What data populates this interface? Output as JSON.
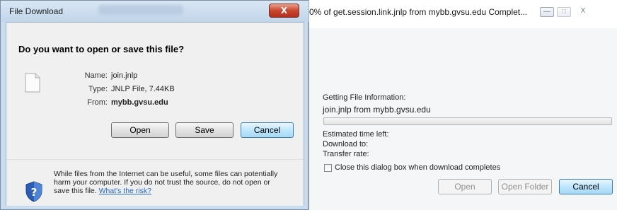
{
  "left_dialog": {
    "title": "File Download",
    "question": "Do you want to open or save this file?",
    "file_info": [
      {
        "label": "Name:",
        "value": "join.jnlp",
        "bold": false
      },
      {
        "label": "Type:",
        "value": "JNLP File, 7.44KB",
        "bold": false
      },
      {
        "label": "From:",
        "value": "mybb.gvsu.edu",
        "bold": true
      }
    ],
    "buttons": {
      "open": "Open",
      "save": "Save",
      "cancel": "Cancel"
    },
    "warning_text": "While files from the Internet can be useful, some files can potentially harm your computer. If you do not trust the source, do not open or save this file.",
    "warning_link": "What's the risk?",
    "close_glyph": "X"
  },
  "right_dialog": {
    "title": "0% of get.session.link.jnlp from mybb.gvsu.edu Complet...",
    "status": "Getting File Information:",
    "file_line": "join.jnlp from mybb.gvsu.edu",
    "progress_fraction": 0,
    "estimated_time_label": "Estimated time left:",
    "download_to_label": "Download to:",
    "transfer_rate_label": "Transfer rate:",
    "checkbox_label": "Close this dialog box when download completes",
    "checkbox_checked": false,
    "buttons": {
      "open": "Open",
      "open_folder": "Open Folder",
      "cancel": "Cancel"
    },
    "caption_glyphs": {
      "minimize": "—",
      "maximize": "□",
      "close": "X"
    }
  },
  "colors": {
    "link": "#1f66c9",
    "close_button": "#c8452e",
    "title_bar": "#c9dced"
  }
}
